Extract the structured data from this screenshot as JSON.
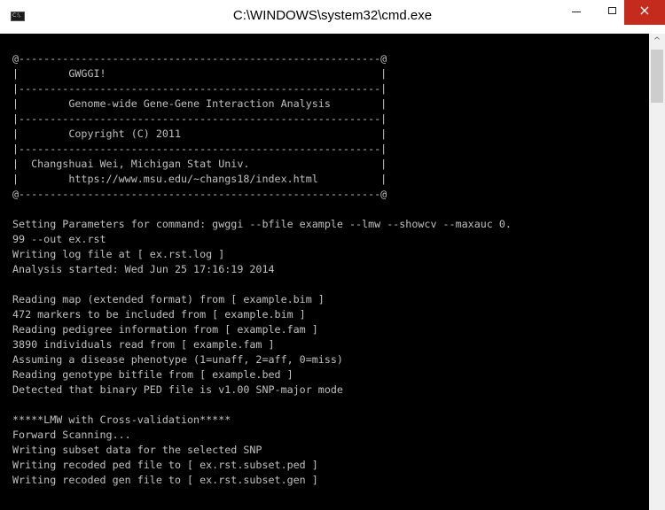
{
  "window": {
    "title": "C:\\WINDOWS\\system32\\cmd.exe",
    "icon_name": "cmd-app-icon",
    "icon_text": "C:\\."
  },
  "controls": {
    "minimize_icon": "minimize-icon",
    "maximize_icon": "maximize-icon",
    "close_icon": "close-icon",
    "close_glyph": "×"
  },
  "scrollbar": {
    "up_arrow_icon": "chevron-up-icon",
    "up_glyph": "^"
  },
  "colors": {
    "console_background": "#000000",
    "console_text": "#c0c0c0",
    "titlebar_background": "#ffffff",
    "close_button": "#c42b1c"
  },
  "console": {
    "lines": [
      "@----------------------------------------------------------@",
      "|        GWGGI!                                            |",
      "|----------------------------------------------------------|",
      "|        Genome-wide Gene-Gene Interaction Analysis        |",
      "|----------------------------------------------------------|",
      "|        Copyright (C) 2011                                |",
      "|----------------------------------------------------------|",
      "|  Changshuai Wei, Michigan Stat Univ.                     |",
      "|        https://www.msu.edu/~changs18/index.html          |",
      "@----------------------------------------------------------@",
      "",
      "Setting Parameters for command: gwggi --bfile example --lmw --showcv --maxauc 0.",
      "99 --out ex.rst",
      "Writing log file at [ ex.rst.log ]",
      "Analysis started: Wed Jun 25 17:16:19 2014",
      "",
      "Reading map (extended format) from [ example.bim ]",
      "472 markers to be included from [ example.bim ]",
      "Reading pedigree information from [ example.fam ]",
      "3890 individuals read from [ example.fam ]",
      "Assuming a disease phenotype (1=unaff, 2=aff, 0=miss)",
      "Reading genotype bitfile from [ example.bed ]",
      "Detected that binary PED file is v1.00 SNP-major mode",
      "",
      "*****LMW with Cross-validation*****",
      "Forward Scanning...",
      "Writing subset data for the selected SNP",
      "Writing recoded ped file to [ ex.rst.subset.ped ]",
      "Writing recoded gen file to [ ex.rst.subset.gen ]"
    ]
  }
}
